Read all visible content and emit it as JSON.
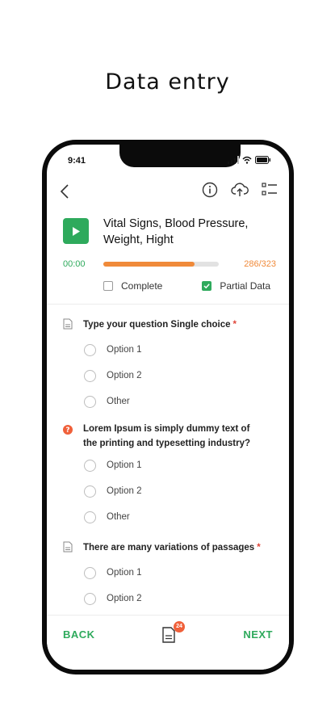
{
  "headline": "Data entry",
  "status_bar": {
    "time": "9:41"
  },
  "form": {
    "title_line1": "Vital Signs, Blood Pressure,",
    "title_line2": "Weight, Hight",
    "time_elapsed": "00:00",
    "progress_fraction": 0.79,
    "counter": "286/323",
    "complete_label": "Complete",
    "complete_checked": false,
    "partial_label": "Partial Data",
    "partial_checked": true
  },
  "questions": [
    {
      "text": "Type your question Single choice",
      "required": "*",
      "icon": "document-icon",
      "options": [
        "Option 1",
        "Option 2",
        "Other"
      ]
    },
    {
      "text_line1": "Lorem Ipsum is simply dummy text of",
      "text_line2": "the printing and typesetting industry?",
      "icon": "help-icon",
      "options": [
        "Option 1",
        "Option 2",
        "Other"
      ]
    },
    {
      "text": "There are many variations of passages",
      "required": "*",
      "icon": "document-icon",
      "options": [
        "Option 1",
        "Option 2"
      ]
    }
  ],
  "bottom_bar": {
    "back_label": "BACK",
    "next_label": "NEXT",
    "badge_count": "24"
  },
  "colors": {
    "accent_green": "#2eaa5c",
    "progress_orange": "#f08a3a",
    "required_red": "#e0463a"
  }
}
